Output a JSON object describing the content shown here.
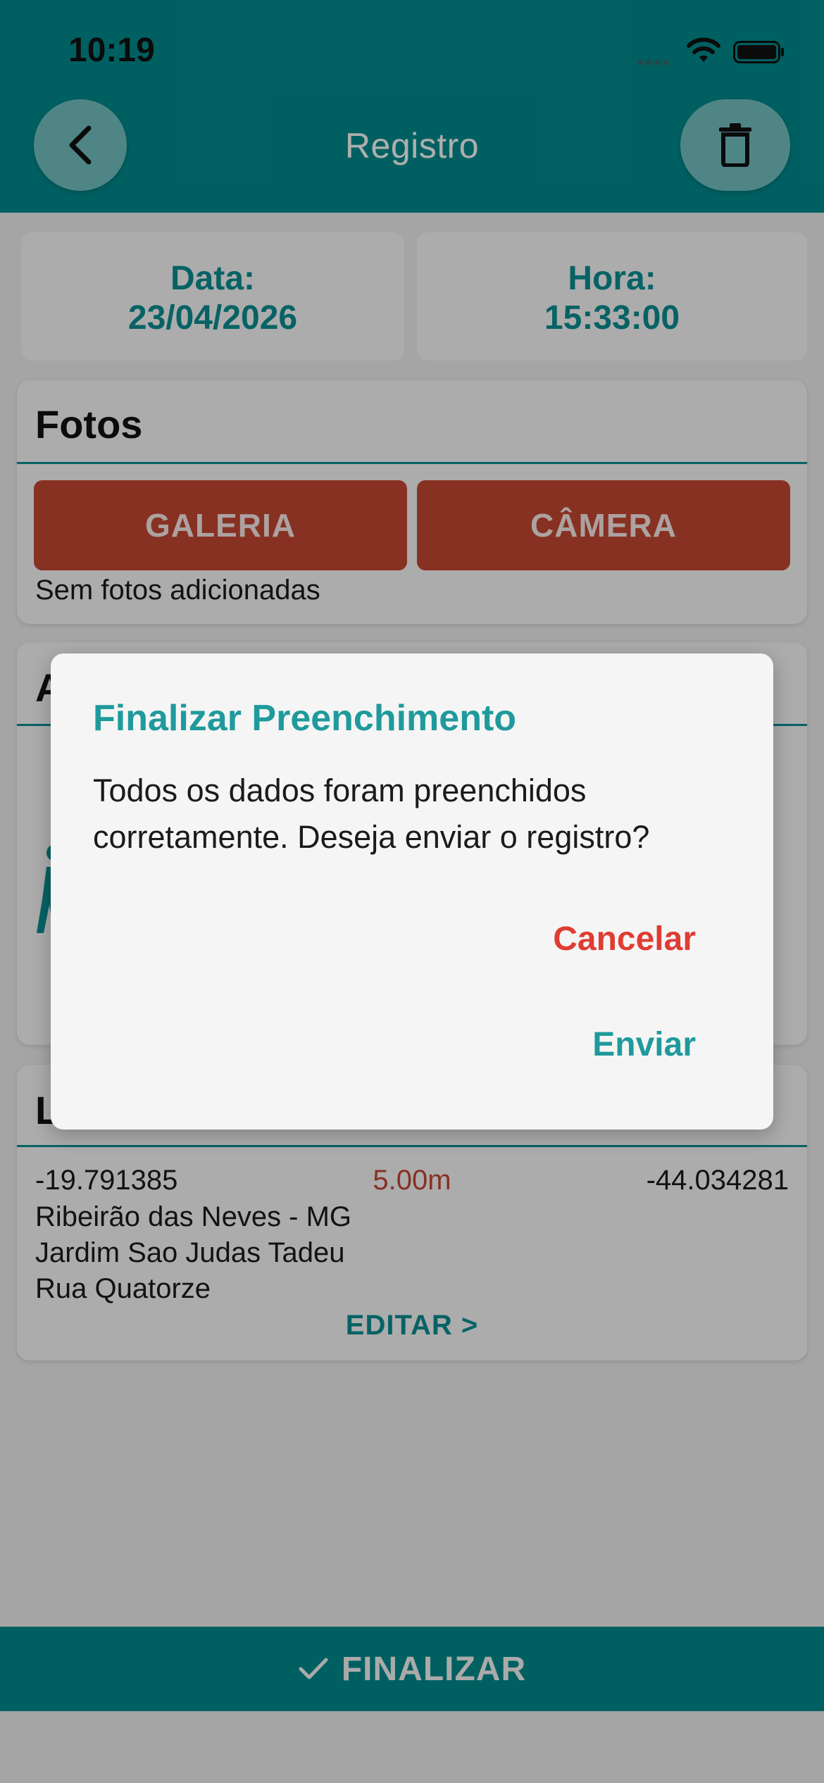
{
  "status_bar": {
    "time": "10:19"
  },
  "header": {
    "title": "Registro",
    "back_icon": "chevron-left-icon",
    "delete_icon": "trash-icon"
  },
  "datetime": {
    "date_label": "Data:",
    "date_value": "23/04/2026",
    "hour_label": "Hora:",
    "hour_value": "15:33:00"
  },
  "photos": {
    "title": "Fotos",
    "gallery_label": "GALERIA",
    "camera_label": "CÂMERA",
    "empty_text": "Sem fotos adicionadas"
  },
  "annotation": {
    "title": "A"
  },
  "location": {
    "title": "L",
    "latitude": "-19.791385",
    "accuracy": "5.00m",
    "longitude": "-44.034281",
    "city": "Ribeirão das Neves - MG",
    "district": "Jardim Sao Judas Tadeu",
    "street": "Rua Quatorze",
    "edit_label": "EDITAR >"
  },
  "footer": {
    "finalize_label": "FINALIZAR",
    "finalize_icon": "checkmark-icon"
  },
  "dialog": {
    "title": "Finalizar Preenchimento",
    "message": "Todos os dados foram preenchidos corretamente. Deseja enviar o registro?",
    "cancel_label": "Cancelar",
    "send_label": "Enviar"
  },
  "colors": {
    "primary": "#018a8c",
    "accent_text": "#0b8d91",
    "action_button": "#c24733",
    "cancel": "#df3c33",
    "dialog_bg": "#f5f5f5"
  }
}
